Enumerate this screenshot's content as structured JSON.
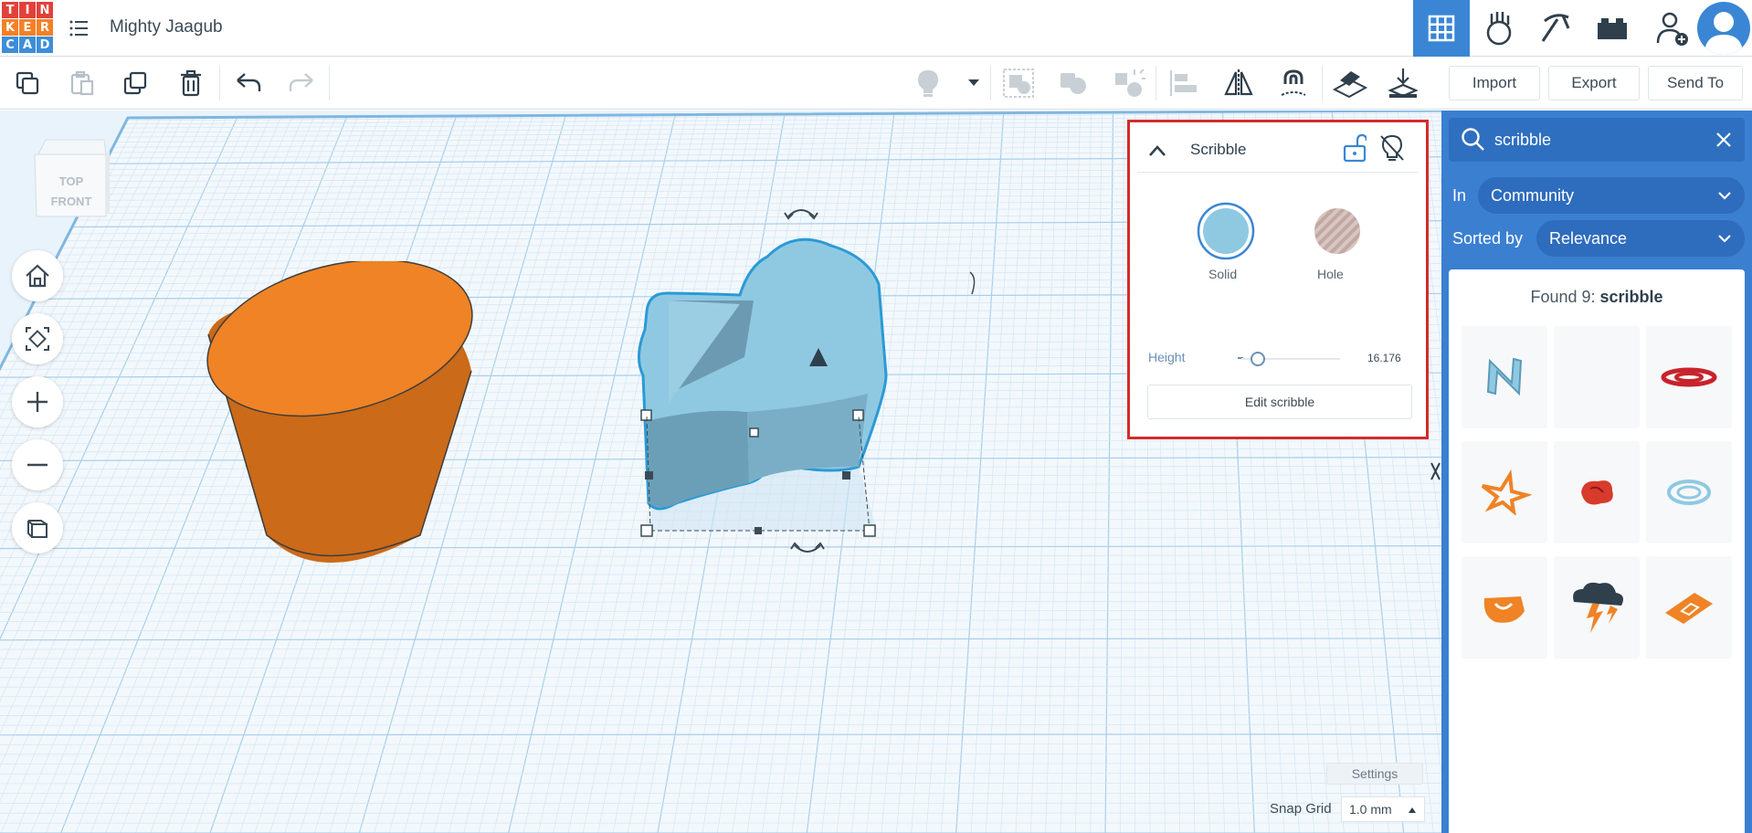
{
  "app": {
    "logo_letters": [
      "T",
      "I",
      "N",
      "K",
      "E",
      "R",
      "C",
      "A",
      "D"
    ],
    "logo_colors": [
      "#e2413a",
      "#e2413a",
      "#e2413a",
      "#f58026",
      "#f58026",
      "#f58026",
      "#3c8ed8",
      "#3c8ed8",
      "#3c8ed8"
    ],
    "project_title": "Mighty Jaagub"
  },
  "header": {
    "views": [
      {
        "name": "3d-design-view-button",
        "icon": "grid-icon",
        "active": true
      },
      {
        "name": "circuits-view-button",
        "icon": "hand-icon",
        "active": false
      },
      {
        "name": "codeblocks-view-button",
        "icon": "pickaxe-icon",
        "active": false
      },
      {
        "name": "bricks-view-button",
        "icon": "brick-icon",
        "active": false
      },
      {
        "name": "add-user-button",
        "icon": "user-add-icon",
        "active": false
      }
    ]
  },
  "toolbar": {
    "import_label": "Import",
    "export_label": "Export",
    "send_to_label": "Send To"
  },
  "viewcube": {
    "top_label": "TOP",
    "front_label": "FRONT"
  },
  "inspector": {
    "title": "Scribble",
    "solid_label": "Solid",
    "hole_label": "Hole",
    "height_label": "Height",
    "height_value": "16.176",
    "edit_label": "Edit scribble",
    "solid_color": "#8fc9e1"
  },
  "search": {
    "query": "scribble",
    "in_label": "In",
    "in_value": "Community",
    "sorted_label": "Sorted by",
    "sorted_value": "Relevance",
    "found_prefix": "Found 9: ",
    "found_term": "scribble"
  },
  "results": [
    {
      "icon": "blue-n-scribble-icon"
    },
    {
      "icon": "empty-tile-icon"
    },
    {
      "icon": "red-swirl-icon"
    },
    {
      "icon": "orange-star-icon"
    },
    {
      "icon": "red-blob-icon"
    },
    {
      "icon": "blue-coil-icon"
    },
    {
      "icon": "orange-knot-icon"
    },
    {
      "icon": "storm-cloud-icon"
    },
    {
      "icon": "orange-plate-icon"
    }
  ],
  "footer": {
    "settings_label": "Settings",
    "snap_grid_label": "Snap Grid",
    "snap_grid_value": "1.0 mm"
  },
  "colors": {
    "accent": "#3a86d4",
    "cylinder": "#ef8325",
    "shape": "#8fc9e1",
    "inspector_highlight": "#d22b2b"
  }
}
